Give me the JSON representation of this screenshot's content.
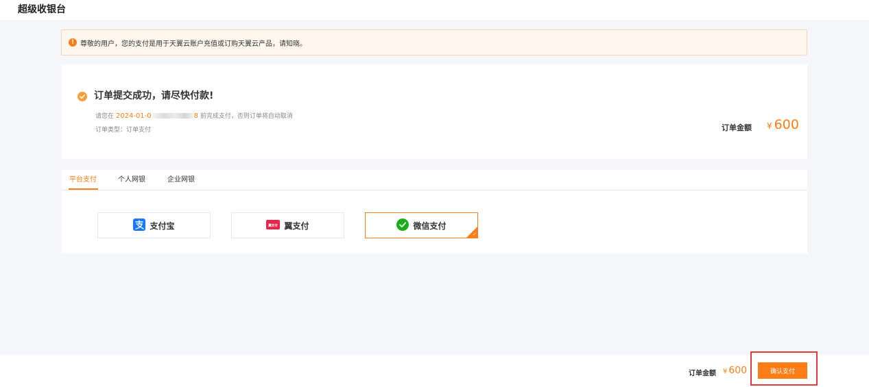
{
  "app": {
    "title": "超级收银台"
  },
  "notice": {
    "text": "尊敬的用户，您的支付是用于天翼云账户充值或订购天翼云产品，请知晓。"
  },
  "order": {
    "title": "订单提交成功，请尽快付款!",
    "deadline_prefix": "请您在",
    "deadline_date_visible": "2024-01-0",
    "deadline_date_tail": "8",
    "deadline_suffix": "前完成支付，否则订单将自动取消",
    "type_text": "订单类型：订单支付",
    "amount_label": "订单金额",
    "currency": "¥",
    "amount": "600"
  },
  "tabs": [
    {
      "label": "平台支付",
      "active": true
    },
    {
      "label": "个人网银",
      "active": false
    },
    {
      "label": "企业网银",
      "active": false
    }
  ],
  "methods": [
    {
      "label": "支付宝",
      "icon": "alipay-icon",
      "selected": false
    },
    {
      "label": "翼支付",
      "icon": "bestpay-icon",
      "icon_text": "翼支付",
      "selected": false
    },
    {
      "label": "微信支付",
      "icon": "wechat-pay-icon",
      "selected": true
    }
  ],
  "footer": {
    "amount_label": "订单金额",
    "currency": "¥",
    "amount": "600",
    "confirm_label": "确认支付"
  },
  "colors": {
    "accent": "#ff7d17",
    "highlight": "#e53935",
    "wechat": "#1aad19",
    "alipay": "#1677ff",
    "bestpay": "#e8264a"
  }
}
